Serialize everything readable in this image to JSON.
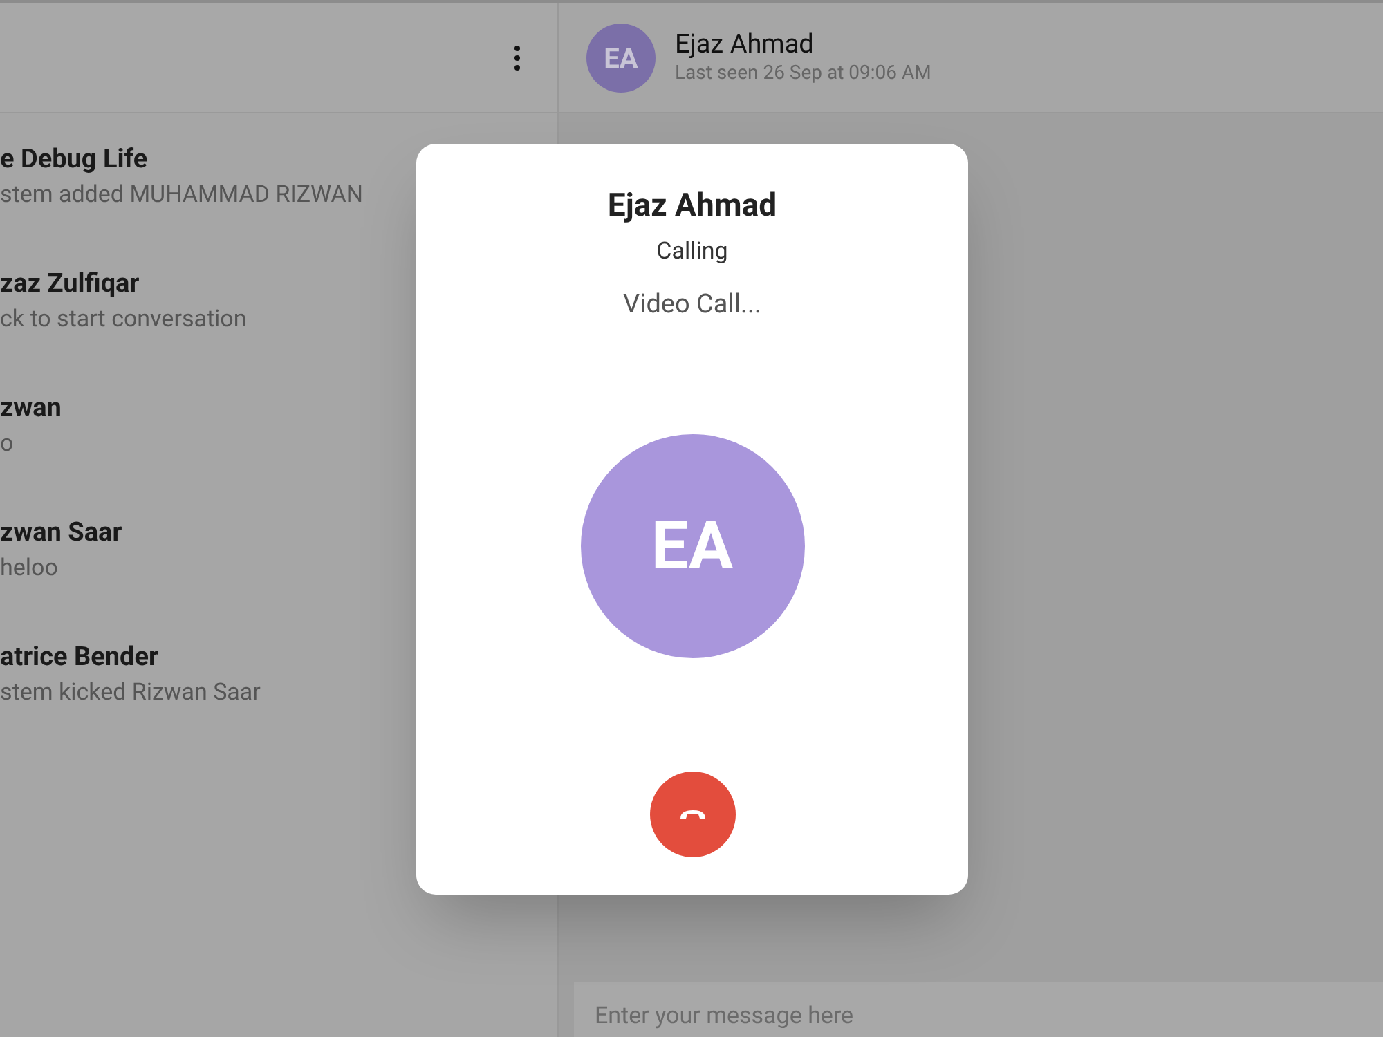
{
  "chat_list": [
    {
      "name": "e Debug Life",
      "preview": "stem added MUHAMMAD RIZWAN"
    },
    {
      "name": "zaz Zulfiqar",
      "preview": "ck to start conversation"
    },
    {
      "name": "zwan",
      "preview": "o"
    },
    {
      "name": "zwan Saar",
      "preview": "heloo"
    },
    {
      "name": "atrice Bender",
      "preview": "stem kicked Rizwan Saar"
    }
  ],
  "chat_header": {
    "initials": "EA",
    "name": "Ejaz Ahmad",
    "last_seen": "Last seen 26 Sep at 09:06 AM"
  },
  "message_input": {
    "placeholder": "Enter your message here"
  },
  "call_dialog": {
    "name": "Ejaz Ahmad",
    "status": "Calling",
    "call_type": "Video Call...",
    "initials": "EA"
  }
}
